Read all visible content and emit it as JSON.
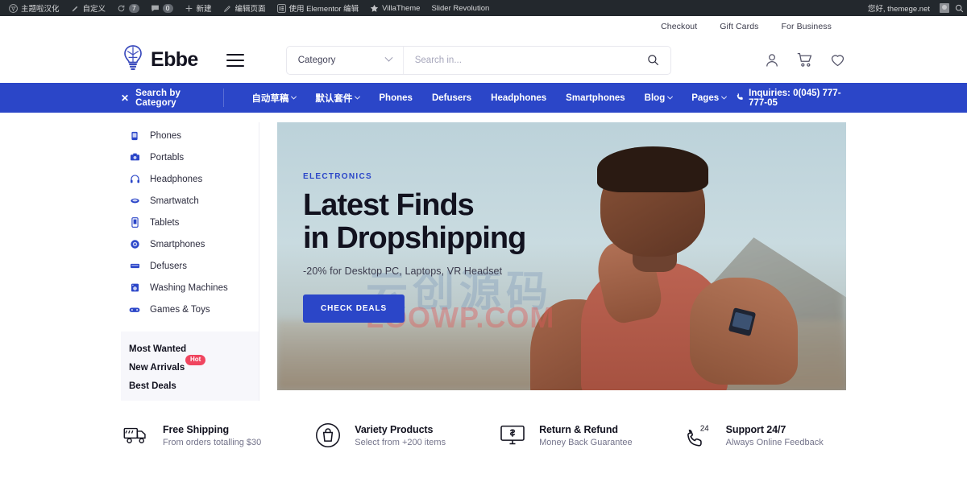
{
  "admin_bar": {
    "items": [
      {
        "icon": "wordpress-icon",
        "label": "主题啦汉化"
      },
      {
        "icon": "pencil-icon",
        "label": "自定义"
      },
      {
        "icon": "refresh-icon",
        "label": "",
        "count": "7"
      },
      {
        "icon": "comment-icon",
        "label": "",
        "count": "0"
      },
      {
        "icon": "plus-icon",
        "label": "新建"
      },
      {
        "icon": "edit-icon",
        "label": "编辑页面"
      },
      {
        "icon": "elementor-icon",
        "label": "使用 Elementor 编辑"
      },
      {
        "icon": "star-icon",
        "label": "VillaTheme"
      },
      {
        "icon": "none",
        "label": "Slider Revolution"
      }
    ],
    "greeting": "您好, themege.net",
    "avatar": "user-avatar",
    "search": "search-icon"
  },
  "utility": {
    "links": [
      "Checkout",
      "Gift Cards",
      "For Business"
    ]
  },
  "header": {
    "logo_text": "Ebbe",
    "logo_icon": "lightbulb-icon",
    "menu_toggle": "hamburger-icon",
    "category_label": "Category",
    "search_placeholder": "Search in...",
    "search_value": "",
    "icons": [
      "account-icon",
      "cart-icon",
      "wishlist-icon"
    ]
  },
  "nav": {
    "category_button": "Search by Category",
    "category_close_icon": "close-icon",
    "items": [
      {
        "label": "自动草稿",
        "has_dropdown": true
      },
      {
        "label": "默认套件",
        "has_dropdown": true
      },
      {
        "label": "Phones",
        "has_dropdown": false
      },
      {
        "label": "Defusers",
        "has_dropdown": false
      },
      {
        "label": "Headphones",
        "has_dropdown": false
      },
      {
        "label": "Smartphones",
        "has_dropdown": false
      },
      {
        "label": "Blog",
        "has_dropdown": true
      },
      {
        "label": "Pages",
        "has_dropdown": true
      }
    ],
    "phone_icon": "phone-icon",
    "phone_text": "Inquiries: 0(045) 777-777-05"
  },
  "sidebar": {
    "items": [
      {
        "label": "Phones",
        "icon": "phone-device-icon"
      },
      {
        "label": "Portabls",
        "icon": "camera-icon"
      },
      {
        "label": "Headphones",
        "icon": "headphones-icon"
      },
      {
        "label": "Smartwatch",
        "icon": "smartwatch-icon"
      },
      {
        "label": "Tablets",
        "icon": "tablet-icon"
      },
      {
        "label": "Smartphones",
        "icon": "smartphone-icon"
      },
      {
        "label": "Defusers",
        "icon": "defuser-icon"
      },
      {
        "label": "Washing Machines",
        "icon": "washing-machine-icon"
      },
      {
        "label": "Games & Toys",
        "icon": "gamepad-icon"
      }
    ],
    "promos": [
      {
        "label": "Most Wanted",
        "badge": ""
      },
      {
        "label": "New Arrivals",
        "badge": "Hot"
      },
      {
        "label": "Best Deals",
        "badge": ""
      }
    ]
  },
  "hero": {
    "eyebrow": "ELECTRONICS",
    "title_line1": "Latest Finds",
    "title_line2": "in Dropshipping",
    "subtitle": "-20% for Desktop PC, Laptops, VR Headset",
    "cta_label": "CHECK DEALS",
    "watermark_cn": "云创源码",
    "watermark_en": "LOOWP.COM"
  },
  "features": [
    {
      "icon": "delivery-truck-icon",
      "title": "Free Shipping",
      "subtitle": "From orders totalling $30"
    },
    {
      "icon": "shopping-bag-icon",
      "title": "Variety Products",
      "subtitle": "Select from +200 items"
    },
    {
      "icon": "monitor-dollar-icon",
      "title": "Return & Refund",
      "subtitle": "Money Back Guarantee"
    },
    {
      "icon": "phone-support-icon",
      "title": "Support 24/7",
      "subtitle": "Always Online Feedback"
    }
  ],
  "colors": {
    "brand_blue": "#2b46c8",
    "admin_dark": "#23282d",
    "hot_red": "#f0455f",
    "text_dark": "#12121f"
  }
}
